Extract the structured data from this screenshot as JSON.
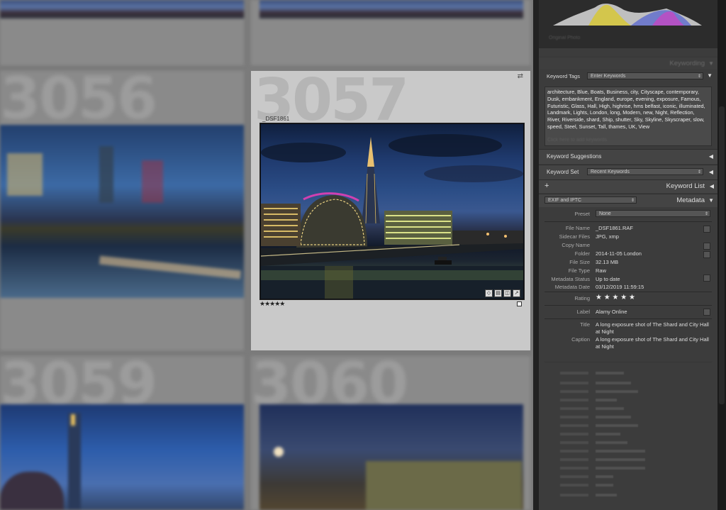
{
  "grid": {
    "cells": [
      {
        "number": "3056"
      },
      {
        "number": "3057"
      },
      {
        "number": "3059"
      },
      {
        "number": "3060"
      }
    ],
    "selected": {
      "number": "3057",
      "filename": "_DSF1861",
      "rating_stars": "★★★★★",
      "rating_value": 5
    }
  },
  "panel": {
    "histogram_label": "Original Photo",
    "keywording": {
      "header": "Keywording",
      "keyword_tags_label": "Keyword Tags",
      "keyword_tags_value": "Enter Keywords",
      "keywords": "architecture, Blue, Boats, Business, city, Cityscape, contemporary, Dusk, embankment, England, europe, evening, exposure, Famous, Futuristic, Glass, Hall, High, highrise, hms belfast, iconic, illuminated, Landmark, Lights, London, long, Modern, new, Night, Reflection, River, Riverside, shard, Ship, shutter, Sky, Skyline, Skyscraper, slow, speed, Steel, Sunset, Tall, thames, UK, View",
      "add_hint": "Click here to add keywords",
      "suggestions_label": "Keyword Suggestions",
      "keyword_set_label": "Keyword Set",
      "keyword_set_value": "Recent Keywords"
    },
    "keyword_list": {
      "header": "Keyword List"
    },
    "metadata": {
      "view": "EXIF and IPTC",
      "header": "Metadata",
      "preset_label": "Preset",
      "preset_value": "None",
      "fields": [
        {
          "label": "File Name",
          "value": "_DSF1861.RAF"
        },
        {
          "label": "Sidecar Files",
          "value": "JPG, xmp"
        },
        {
          "label": "Copy Name",
          "value": ""
        },
        {
          "label": "Folder",
          "value": "2014-11-05 London"
        },
        {
          "label": "File Size",
          "value": "32.13 MB"
        },
        {
          "label": "File Type",
          "value": "Raw"
        },
        {
          "label": "Metadata Status",
          "value": "Up to date"
        },
        {
          "label": "Metadata Date",
          "value": "03/12/2019 11:59:15"
        }
      ],
      "rating_label": "Rating",
      "rating_stars": "★ ★ ★ ★ ★",
      "label_label": "Label",
      "label_value": "Alamy Online",
      "title_label": "Title",
      "title_value": "A long exposure shot of The Shard and City Hall at Night",
      "caption_label": "Caption",
      "caption_value": "A long exposure shot of The Shard and City Hall at Night"
    }
  }
}
